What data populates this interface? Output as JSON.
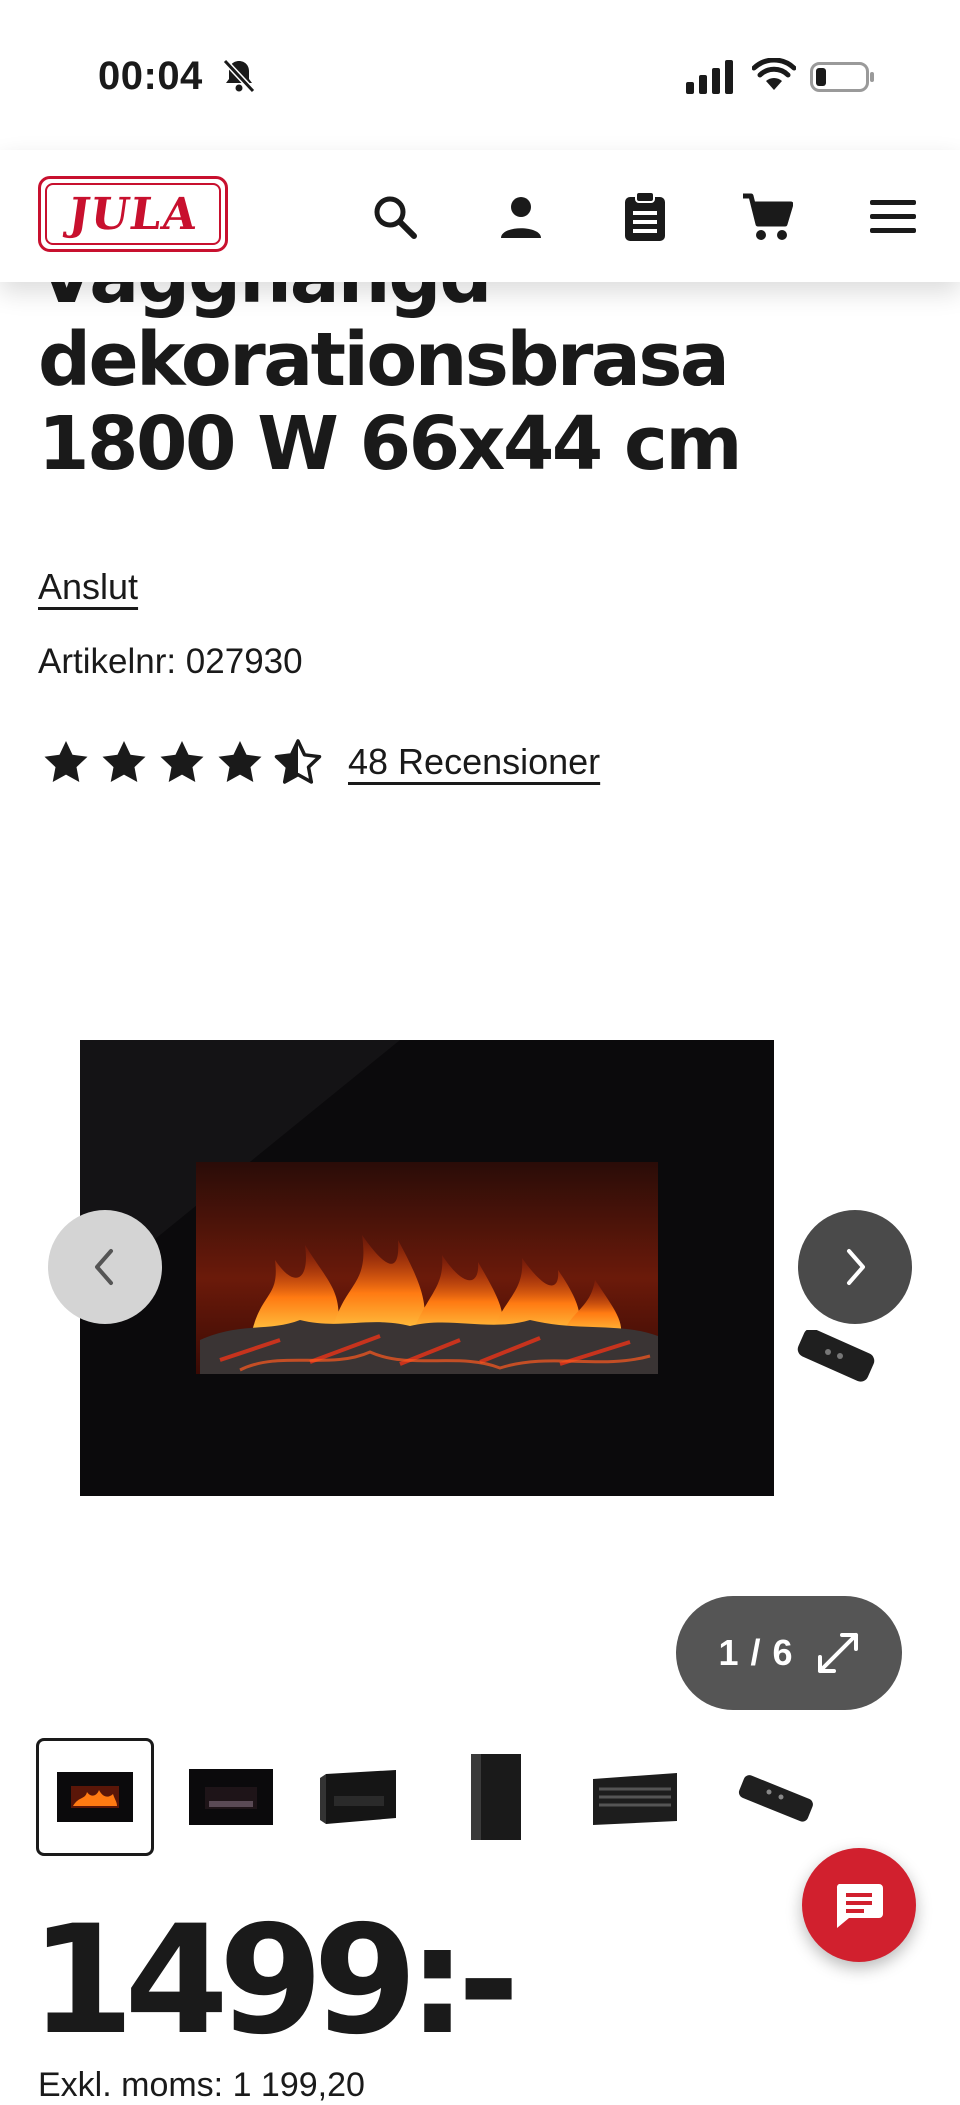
{
  "status_bar": {
    "time": "00:04",
    "icons": [
      "bell-slash-icon",
      "signal-icon",
      "wifi-icon",
      "battery-icon"
    ]
  },
  "header": {
    "logo_text": "JULA",
    "icons": [
      "search-icon",
      "user-icon",
      "clipboard-icon",
      "cart-icon",
      "menu-icon"
    ],
    "accent_color": "#c8102e"
  },
  "product": {
    "title_partial_line": "Vägghängd",
    "title": "dekorationsbrasa 1800 W 66x44 cm",
    "brand": "Anslut",
    "article_number": "Artikelnr: 027930",
    "rating_value": 4.5,
    "rating_max": 5,
    "reviews_label": "48 Recensioner"
  },
  "gallery": {
    "counter": "1 / 6",
    "current": 1,
    "total": 6,
    "thumbnails": [
      "fireplace-front",
      "fireplace-dark",
      "fireplace-angled",
      "fireplace-side",
      "fireplace-top",
      "remote-control"
    ]
  },
  "pricing": {
    "price": "1499:-",
    "ex_vat": "Exkl. moms: 1 199,20"
  },
  "chat": {
    "icon": "chat-icon",
    "color": "#d1202e"
  }
}
